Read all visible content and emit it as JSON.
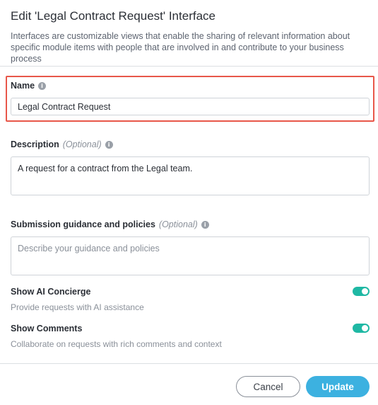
{
  "dialog": {
    "title": "Edit 'Legal Contract Request' Interface",
    "subtitle": "Interfaces are customizable views that enable the sharing of relevant information about specific module items with people that are involved in and contribute to your business process"
  },
  "fields": {
    "name": {
      "label": "Name",
      "value": "Legal Contract Request"
    },
    "description": {
      "label": "Description",
      "optional": "(Optional)",
      "value": "A request for a contract from the Legal team."
    },
    "guidance": {
      "label": "Submission guidance and policies",
      "optional": "(Optional)",
      "placeholder": "Describe your guidance and policies"
    }
  },
  "toggles": {
    "ai_concierge": {
      "title": "Show AI Concierge",
      "subtitle": "Provide requests with AI assistance",
      "enabled": true
    },
    "comments": {
      "title": "Show Comments",
      "subtitle": "Collaborate on requests with rich comments and context",
      "enabled": true
    }
  },
  "buttons": {
    "cancel": "Cancel",
    "update": "Update"
  },
  "colors": {
    "highlight": "#e8574a",
    "toggle_on": "#1fb8a4",
    "primary": "#3cb1e0"
  },
  "icons": {
    "info": "info-icon"
  }
}
